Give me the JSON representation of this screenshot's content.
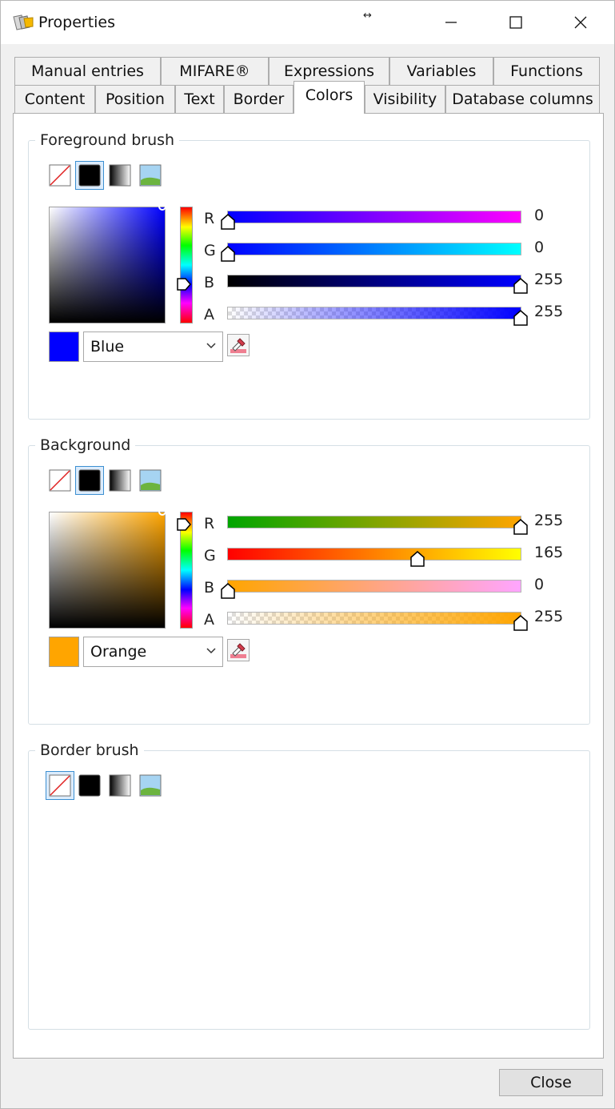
{
  "window": {
    "title": "Properties",
    "resize_glyph": "↔"
  },
  "tabs_row1": [
    {
      "label": "Manual entries"
    },
    {
      "label": "MIFARE®"
    },
    {
      "label": "Expressions"
    },
    {
      "label": "Variables"
    },
    {
      "label": "Functions"
    }
  ],
  "tabs_row2": [
    {
      "label": "Content"
    },
    {
      "label": "Position"
    },
    {
      "label": "Text"
    },
    {
      "label": "Border"
    },
    {
      "label": "Colors"
    },
    {
      "label": "Visibility"
    },
    {
      "label": "Database columns"
    }
  ],
  "selected_tab": "Colors",
  "brush_types": [
    "none",
    "solid",
    "gradient",
    "image"
  ],
  "foreground": {
    "title": "Foreground brush",
    "selected_brush": "solid",
    "channels": [
      {
        "label": "R",
        "value": "0"
      },
      {
        "label": "G",
        "value": "0"
      },
      {
        "label": "B",
        "value": "255"
      },
      {
        "label": "A",
        "value": "255"
      }
    ],
    "color_name": "Blue",
    "color_hex": "#0000ff",
    "hue_fraction": 0.66
  },
  "background": {
    "title": "Background",
    "selected_brush": "solid",
    "channels": [
      {
        "label": "R",
        "value": "255"
      },
      {
        "label": "G",
        "value": "165"
      },
      {
        "label": "B",
        "value": "0"
      },
      {
        "label": "A",
        "value": "255"
      }
    ],
    "color_name": "Orange",
    "color_hex": "#ffa500",
    "hue_fraction": 0.11
  },
  "border": {
    "title": "Border brush",
    "selected_brush": "none"
  },
  "footer": {
    "close_label": "Close"
  },
  "icons": {
    "app": "labeling-app-logo-icon",
    "minimize": "minimize-icon",
    "maximize": "maximize-icon",
    "close": "close-icon",
    "none_brush": "no-brush-icon",
    "solid_brush": "solid-brush-icon",
    "gradient_brush": "gradient-brush-icon",
    "image_brush": "image-brush-icon",
    "eyedropper": "eyedropper-icon",
    "dropdown": "chevron-down-icon"
  }
}
